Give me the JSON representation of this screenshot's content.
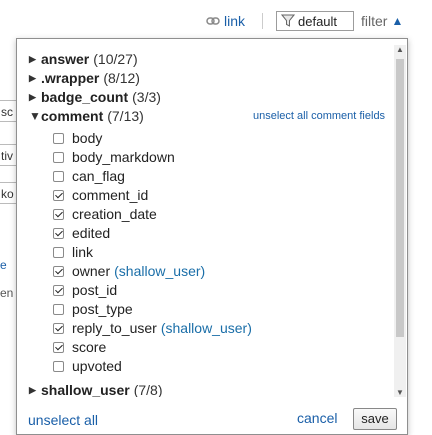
{
  "background": {
    "inputs": [
      "sc",
      "tiv",
      "ko"
    ],
    "links": [
      "e",
      "en"
    ]
  },
  "topbar": {
    "link_label": "link",
    "filter_value": "default",
    "filter_label": "filter"
  },
  "groups": {
    "answer": {
      "label": "answer",
      "count": "(10/27)"
    },
    "wrapper": {
      "label": ".wrapper",
      "count": "(8/12)"
    },
    "badge_count": {
      "label": "badge_count",
      "count": "(3/3)"
    },
    "comment": {
      "label": "comment",
      "count": "(7/13)",
      "unselect_label": "unselect all comment fields"
    },
    "shallow_user": {
      "label": "shallow_user",
      "count": "(7/8)"
    }
  },
  "comment_fields": [
    {
      "label": "body",
      "checked": false,
      "type": ""
    },
    {
      "label": "body_markdown",
      "checked": false,
      "type": ""
    },
    {
      "label": "can_flag",
      "checked": false,
      "type": ""
    },
    {
      "label": "comment_id",
      "checked": true,
      "type": ""
    },
    {
      "label": "creation_date",
      "checked": true,
      "type": ""
    },
    {
      "label": "edited",
      "checked": true,
      "type": ""
    },
    {
      "label": "link",
      "checked": false,
      "type": ""
    },
    {
      "label": "owner",
      "checked": true,
      "type": "(shallow_user)"
    },
    {
      "label": "post_id",
      "checked": true,
      "type": ""
    },
    {
      "label": "post_type",
      "checked": false,
      "type": ""
    },
    {
      "label": "reply_to_user",
      "checked": true,
      "type": "(shallow_user)"
    },
    {
      "label": "score",
      "checked": true,
      "type": ""
    },
    {
      "label": "upvoted",
      "checked": false,
      "type": ""
    }
  ],
  "footer": {
    "unselect_all": "unselect all",
    "cancel": "cancel",
    "save": "save"
  },
  "colors": {
    "link": "#1a5fa8",
    "type_hint": "#1a6ea8"
  }
}
